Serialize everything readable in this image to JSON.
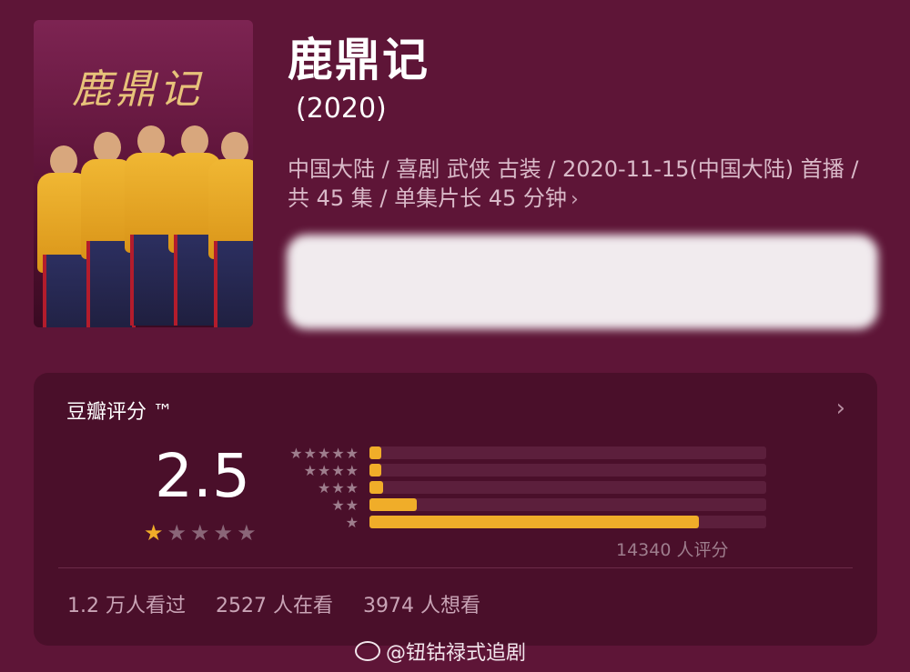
{
  "poster": {
    "title_text": "鹿鼎记"
  },
  "movie": {
    "title": "鹿鼎记",
    "year": "(2020)",
    "info": "中国大陆 / 喜剧 武侠 古装 / 2020-11-15(中国大陆) 首播 / 共 45 集 / 单集片长 45 分钟",
    "info_chevron": "›"
  },
  "rating": {
    "label": "豆瓣评分 ™",
    "chevron": "›",
    "score": "2.5",
    "score_stars_filled": 1,
    "score_stars_total": 5,
    "distribution": [
      {
        "stars": 5,
        "label": "★★★★★",
        "fraction": 0.03
      },
      {
        "stars": 4,
        "label": "★★★★",
        "fraction": 0.03
      },
      {
        "stars": 3,
        "label": "★★★",
        "fraction": 0.035
      },
      {
        "stars": 2,
        "label": "★★",
        "fraction": 0.12
      },
      {
        "stars": 1,
        "label": "★",
        "fraction": 0.83
      }
    ],
    "count": "14340 人评分"
  },
  "stats": {
    "watched": "1.2 万人看过",
    "watching": "2527 人在看",
    "want": "3974 人想看"
  },
  "watermark": {
    "text": "@钮钴禄式追剧"
  },
  "colors": {
    "accent": "#f0ad29",
    "background": "#5e1537",
    "panel": "#4a0f2a"
  }
}
